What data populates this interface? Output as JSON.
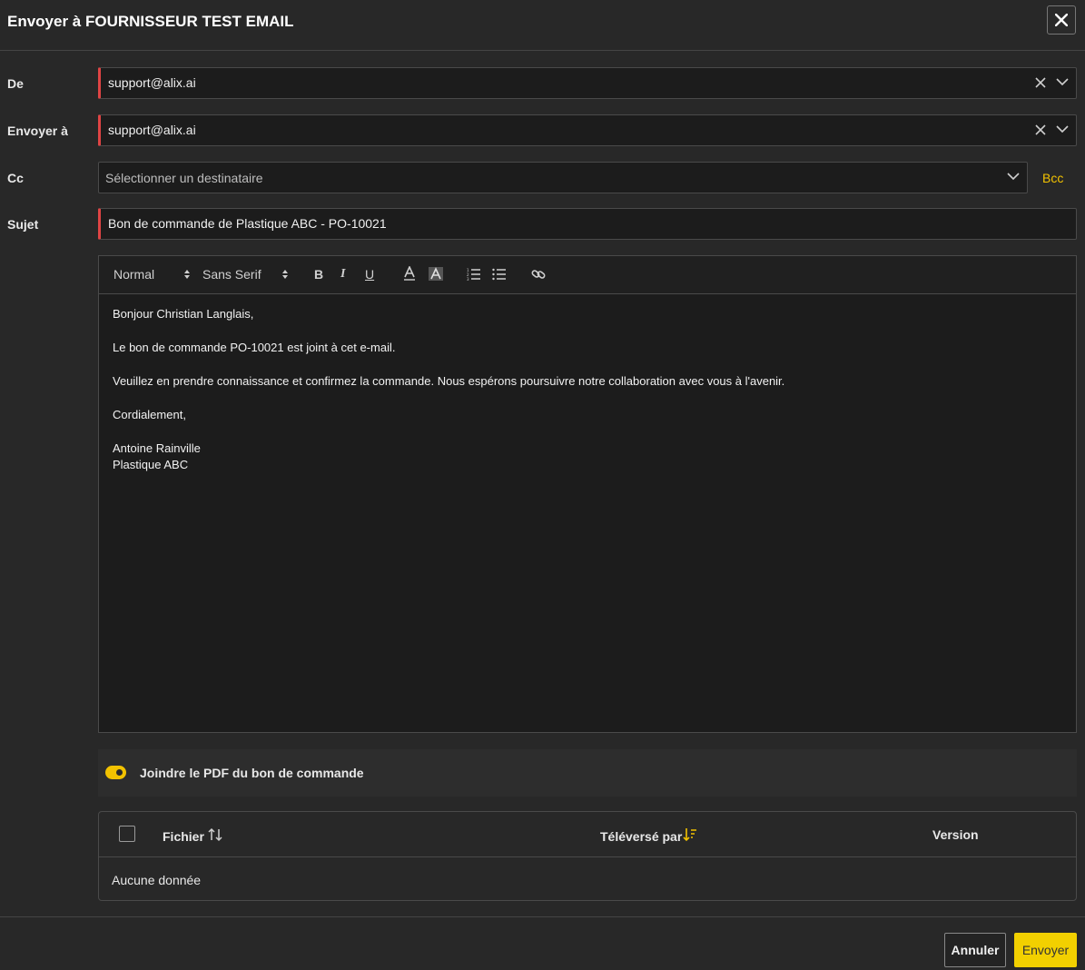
{
  "dialog": {
    "title": "Envoyer à FOURNISSEUR TEST EMAIL"
  },
  "form": {
    "from_label": "De",
    "from_value": "support@alix.ai",
    "to_label": "Envoyer à",
    "to_value": "support@alix.ai",
    "cc_label": "Cc",
    "cc_placeholder": "Sélectionner un destinataire",
    "bcc_label": "Bcc",
    "subject_label": "Sujet",
    "subject_value": "Bon de commande de Plastique ABC - PO-10021"
  },
  "toolbar": {
    "heading_select": "Normal",
    "font_select": "Sans Serif",
    "bold": "B",
    "italic": "I",
    "underline": "U"
  },
  "message": {
    "greeting": "Bonjour Christian Langlais,",
    "line1": "Le bon de commande PO-10021 est joint à cet e-mail.",
    "line2": "Veuillez en prendre connaissance et confirmez la commande. Nous espérons poursuivre notre collaboration avec vous à l'avenir.",
    "closing": "Cordialement,",
    "signature_name": "Antoine Rainville",
    "signature_company": "Plastique ABC"
  },
  "attachment": {
    "toggle_label": "Joindre le PDF du bon de commande",
    "enabled": true
  },
  "table": {
    "columns": [
      "Fichier",
      "Téléversé par",
      "Version"
    ],
    "empty_text": "Aucune donnée"
  },
  "footer": {
    "cancel_label": "Annuler",
    "send_label": "Envoyer"
  },
  "colors": {
    "accent": "#f2d000",
    "required": "#e04444",
    "background": "#282828"
  }
}
